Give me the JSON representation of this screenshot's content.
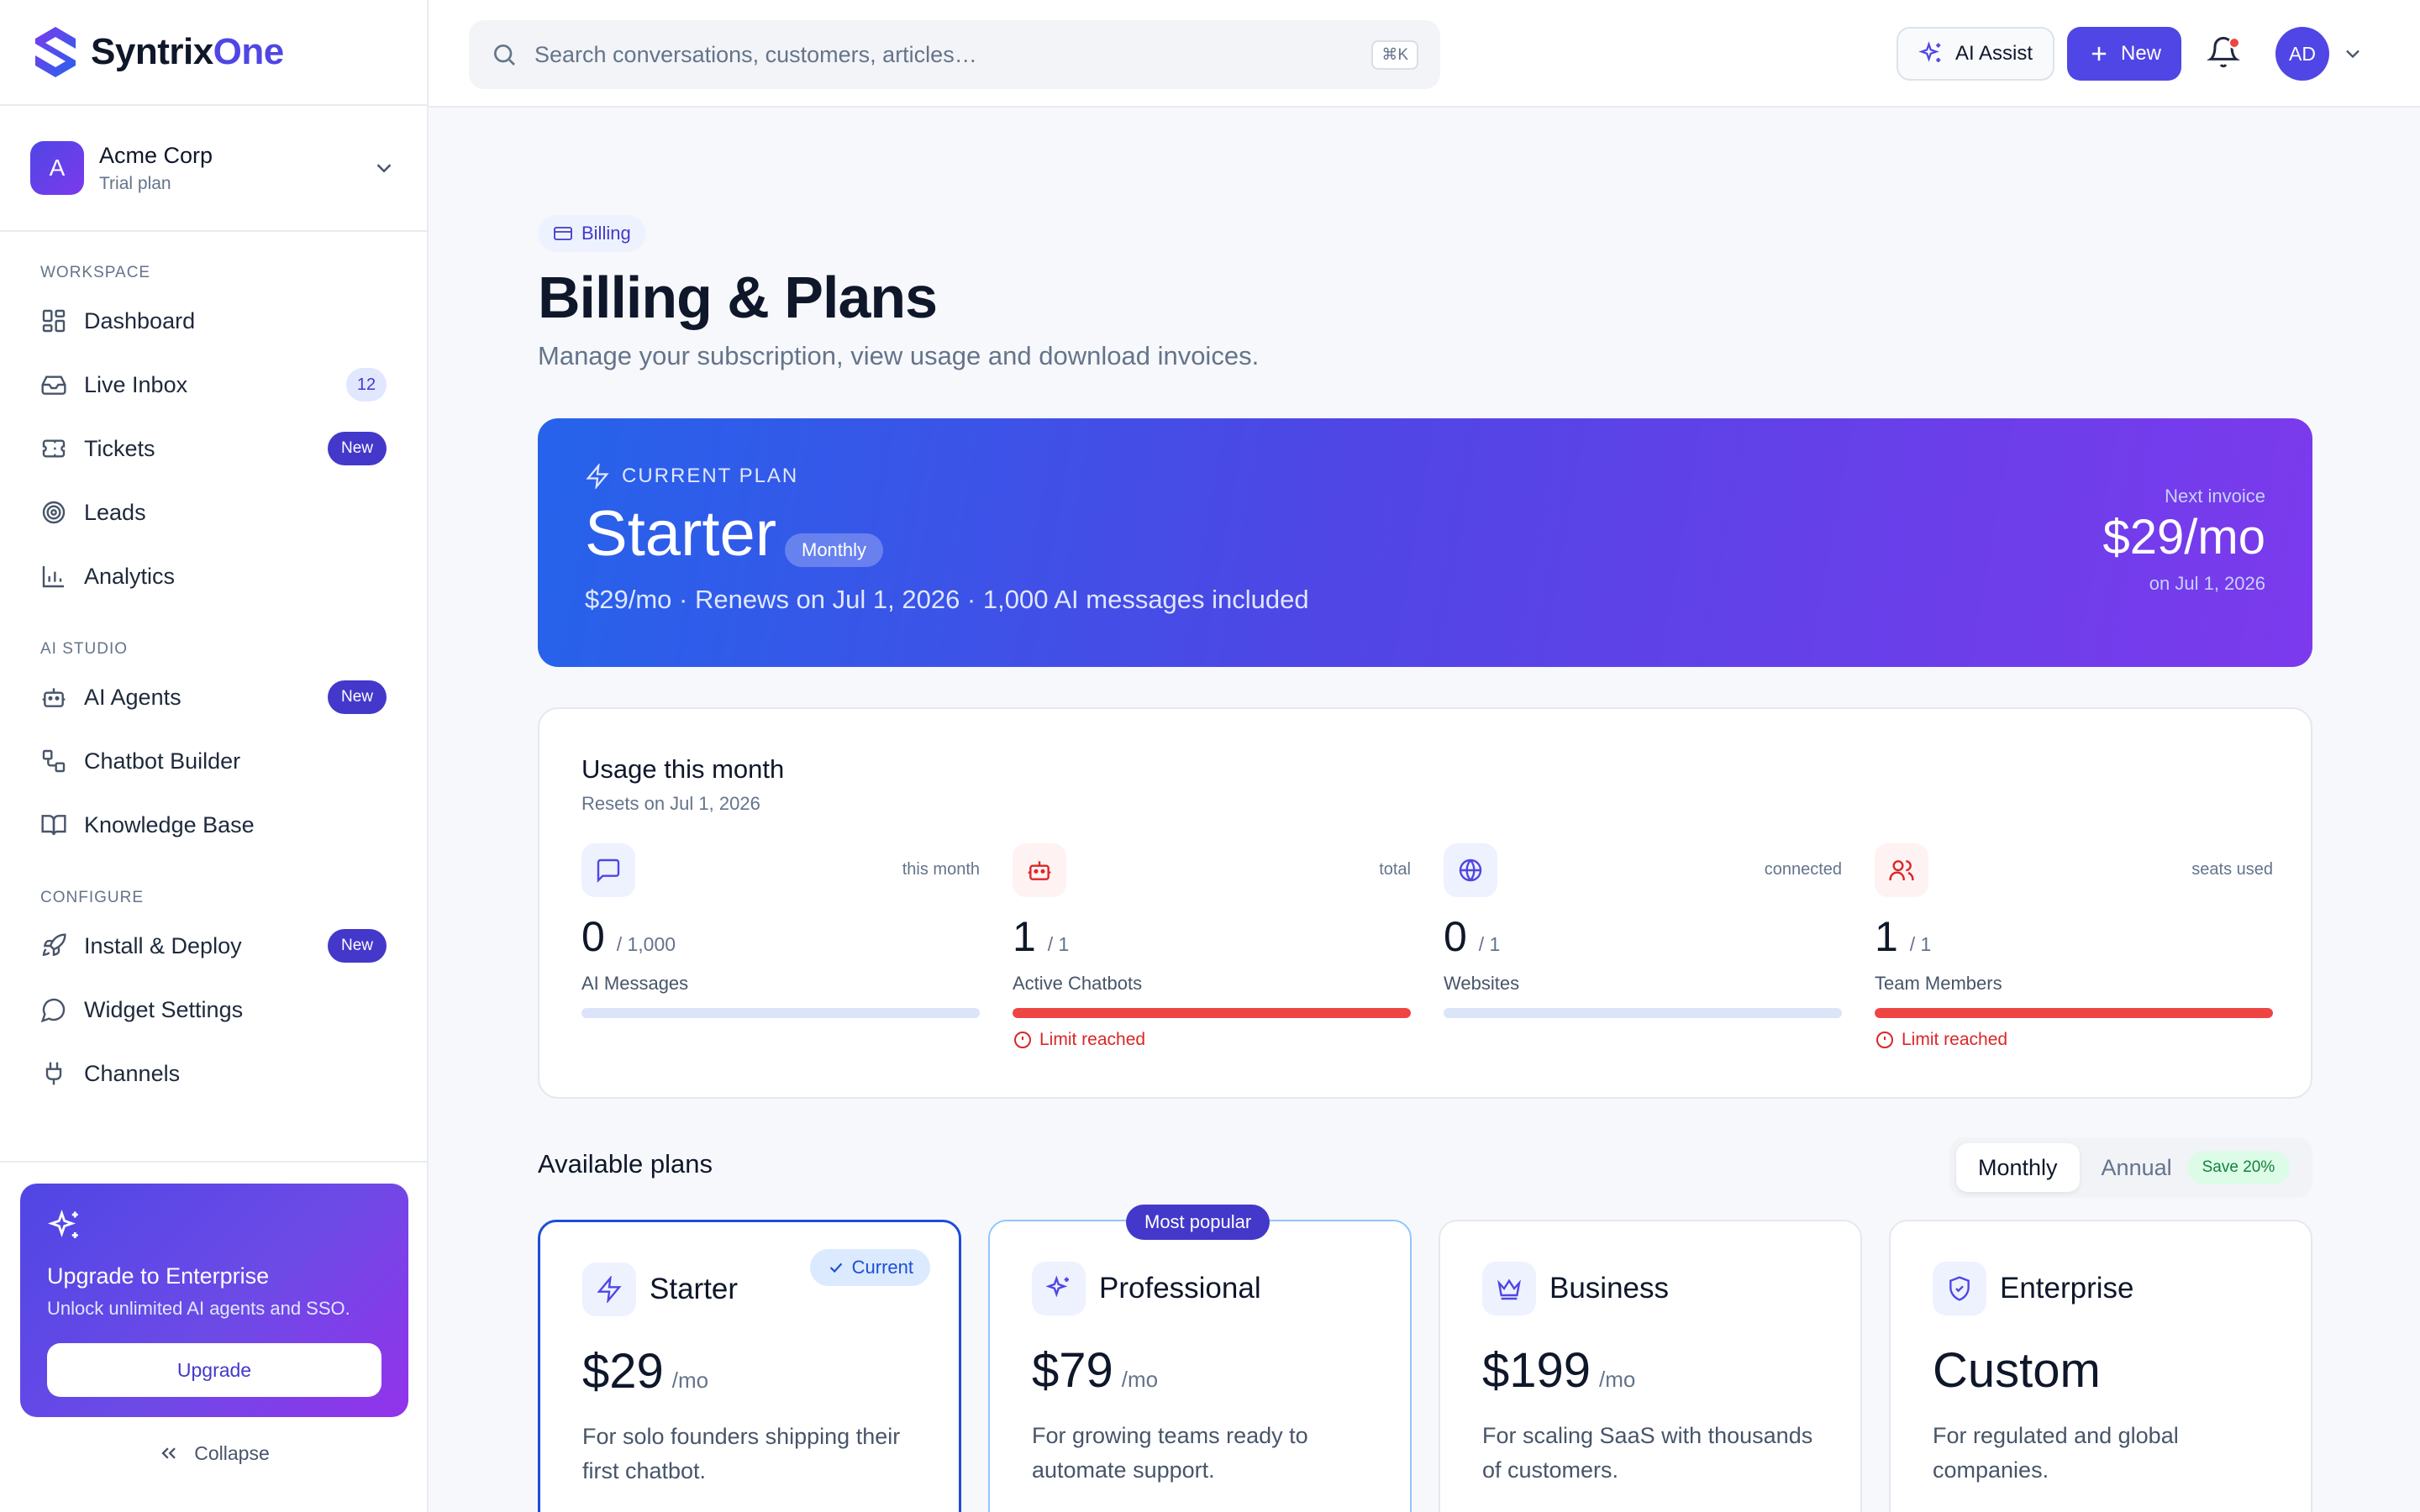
{
  "brand": {
    "name_main": "Syntrix",
    "name_accent": "One"
  },
  "workspace": {
    "initial": "A",
    "name": "Acme Corp",
    "plan": "Trial plan"
  },
  "nav": {
    "sections": [
      {
        "label": "WORKSPACE",
        "items": [
          {
            "label": "Dashboard",
            "icon": "dashboard-icon"
          },
          {
            "label": "Live Inbox",
            "icon": "inbox-icon",
            "count": "12"
          },
          {
            "label": "Tickets",
            "icon": "ticket-icon",
            "badge": "New"
          },
          {
            "label": "Leads",
            "icon": "target-icon"
          },
          {
            "label": "Analytics",
            "icon": "bar-chart-icon"
          }
        ]
      },
      {
        "label": "AI STUDIO",
        "items": [
          {
            "label": "AI Agents",
            "icon": "bot-icon",
            "badge": "New"
          },
          {
            "label": "Chatbot Builder",
            "icon": "workflow-icon"
          },
          {
            "label": "Knowledge Base",
            "icon": "book-icon"
          }
        ]
      },
      {
        "label": "CONFIGURE",
        "items": [
          {
            "label": "Install & Deploy",
            "icon": "rocket-icon",
            "badge": "New"
          },
          {
            "label": "Widget Settings",
            "icon": "chat-bubble-icon"
          },
          {
            "label": "Channels",
            "icon": "plug-icon"
          }
        ]
      }
    ]
  },
  "upgrade": {
    "title": "Upgrade to Enterprise",
    "subtitle": "Unlock unlimited AI agents and SSO.",
    "button": "Upgrade"
  },
  "collapse_label": "Collapse",
  "topbar": {
    "search_placeholder": "Search conversations, customers, articles…",
    "shortcut": "⌘K",
    "ai_assist": "AI Assist",
    "new_label": "New",
    "user_initials": "AD"
  },
  "page": {
    "breadcrumb": "Billing",
    "title": "Billing & Plans",
    "subtitle": "Manage your subscription, view usage and download invoices."
  },
  "current_plan": {
    "label": "CURRENT PLAN",
    "name": "Starter",
    "frequency": "Monthly",
    "details": "$29/mo · Renews on Jul 1, 2026 · 1,000 AI messages included",
    "next_invoice_label": "Next invoice",
    "next_invoice_amount": "$29/mo",
    "next_invoice_date": "on Jul 1, 2026"
  },
  "usage": {
    "title": "Usage this month",
    "subtitle": "Resets on Jul 1, 2026",
    "meters": [
      {
        "name": "AI Messages",
        "value": "0",
        "limit": "/ 1,000",
        "tag": "this month",
        "icon": "message-square-icon",
        "tone": "blue",
        "fill": 0,
        "warning": ""
      },
      {
        "name": "Active Chatbots",
        "value": "1",
        "limit": "/ 1",
        "tag": "total",
        "icon": "bot-icon",
        "tone": "red",
        "fill": 1,
        "warning": "Limit reached"
      },
      {
        "name": "Websites",
        "value": "0",
        "limit": "/ 1",
        "tag": "connected",
        "icon": "globe-icon",
        "tone": "blue",
        "fill": 0,
        "warning": ""
      },
      {
        "name": "Team Members",
        "value": "1",
        "limit": "/ 1",
        "tag": "seats used",
        "icon": "users-icon",
        "tone": "red",
        "fill": 1,
        "warning": "Limit reached"
      }
    ]
  },
  "plans": {
    "title": "Available plans",
    "billing_toggle": {
      "monthly": "Monthly",
      "annual": "Annual",
      "save": "Save 20%",
      "selected": "Monthly"
    },
    "cards": [
      {
        "name": "Starter",
        "price": "$29",
        "period": "/mo",
        "desc": "For solo founders shipping their first chatbot.",
        "icon": "zap-icon",
        "badge": "Current",
        "state": "current"
      },
      {
        "name": "Professional",
        "price": "$79",
        "period": "/mo",
        "desc": "For growing teams ready to automate support.",
        "icon": "sparkles-icon",
        "badge": "Most popular",
        "state": "popular"
      },
      {
        "name": "Business",
        "price": "$199",
        "period": "/mo",
        "desc": "For scaling SaaS with thousands of customers.",
        "icon": "crown-icon",
        "badge": "",
        "state": ""
      },
      {
        "name": "Enterprise",
        "price": "Custom",
        "period": "",
        "desc": "For regulated and global companies.",
        "icon": "shield-check-icon",
        "badge": "",
        "state": ""
      }
    ]
  },
  "colors": {
    "accent": "#4f46e5",
    "danger": "#ef4444",
    "success": "#15803d"
  }
}
